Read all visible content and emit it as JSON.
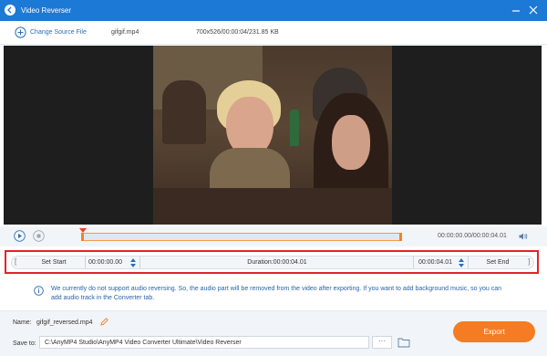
{
  "window": {
    "title": "Video Reverser",
    "icons": {
      "app": "reverse-logo-icon",
      "minimize": "minimize-icon",
      "close": "close-icon"
    }
  },
  "filebar": {
    "change_source_label": "Change Source File",
    "filename": "gifgif.mp4",
    "fileinfo": "700x526/00:00:04/231.85 KB"
  },
  "playback": {
    "time_display": "00:00:00.00/00:00:04.01",
    "icons": {
      "play": "play-icon",
      "stop": "stop-icon",
      "volume": "volume-icon"
    },
    "playhead_fraction": 0.0
  },
  "set_range": {
    "left_bracket": "[",
    "right_bracket": "]",
    "set_start_label": "Set Start",
    "start_time": "00:00:00.00",
    "duration_label": "Duration:00:00:04.01",
    "end_time": "00:00:04.01",
    "set_end_label": "Set End"
  },
  "notice": {
    "text": "We currently do not support audio reversing. So, the audio part will be removed from the video after exporting. If you want to add background music, so you can add audio track in the Converter tab."
  },
  "output": {
    "name_label": "Name:",
    "name_value": "gifgif_reversed.mp4",
    "save_label": "Save to:",
    "save_path": "C:\\AnyMP4 Studio\\AnyMP4 Video Converter Ultimate\\Video Reverser",
    "browse_label": "···",
    "export_label": "Export"
  },
  "colors": {
    "titlebar": "#1d79d6",
    "accent": "#f57c22",
    "highlight_border": "#e0242b",
    "link": "#2c6fb8"
  }
}
